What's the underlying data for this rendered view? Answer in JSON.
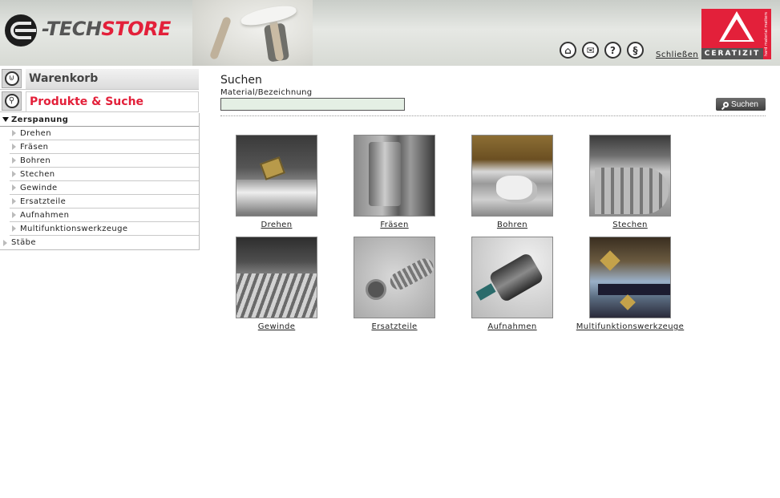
{
  "header": {
    "logo_prefix": "-TECH",
    "logo_suffix": "STORE",
    "icons": [
      "home-icon",
      "mail-icon",
      "help-icon",
      "legal-icon"
    ],
    "close_label": "Schließen",
    "brand_name": "CERATIZIT",
    "brand_slogan": "hard material matters",
    "brand_color": "#e3203a"
  },
  "sidebar": {
    "cart_label": "Warenkorb",
    "products_label": "Produkte & Suche",
    "tree": {
      "parent": "Zerspanung",
      "children": [
        "Drehen",
        "Fräsen",
        "Bohren",
        "Stechen",
        "Gewinde",
        "Ersatzteile",
        "Aufnahmen",
        "Multifunktionswerkzeuge"
      ],
      "sibling": "Stäbe"
    }
  },
  "main": {
    "search_title": "Suchen",
    "field_label": "Material/Bezeichnung",
    "field_value": "",
    "search_button": "Suchen",
    "categories": [
      "Drehen",
      "Fräsen",
      "Bohren",
      "Stechen",
      "Gewinde",
      "Ersatzteile",
      "Aufnahmen",
      "Multifunktionswerkzeuge"
    ]
  }
}
